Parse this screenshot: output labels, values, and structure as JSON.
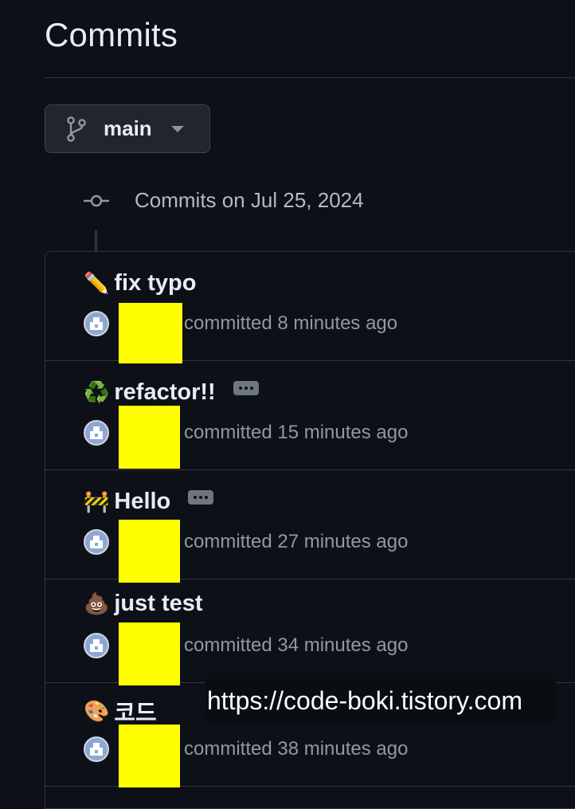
{
  "page": {
    "title": "Commits"
  },
  "branch": {
    "name": "main"
  },
  "timeline": {
    "date_heading": "Commits on Jul 25, 2024"
  },
  "commits": [
    {
      "emoji": "✏️",
      "title": "fix typo",
      "author": "0",
      "meta": "committed 8 minutes ago",
      "has_ellipsis": false
    },
    {
      "emoji": "♻️",
      "title": "refactor!!",
      "author": "0",
      "meta": "committed 15 minutes ago",
      "has_ellipsis": true
    },
    {
      "emoji": "🚧",
      "title": "Hello",
      "author": "0",
      "meta": "committed 27 minutes ago",
      "has_ellipsis": true
    },
    {
      "emoji": "💩",
      "title": "just test",
      "author": "0",
      "meta": "committed 34 minutes ago",
      "has_ellipsis": false
    },
    {
      "emoji": "🎨",
      "title": "코드",
      "author": "0",
      "meta": "committed 38 minutes ago",
      "has_ellipsis": false
    }
  ],
  "watermark": {
    "text": "https://code-boki.tistory.com"
  },
  "colors": {
    "background": "#0d1117",
    "border": "#30363d",
    "redaction": "#ffff00"
  }
}
